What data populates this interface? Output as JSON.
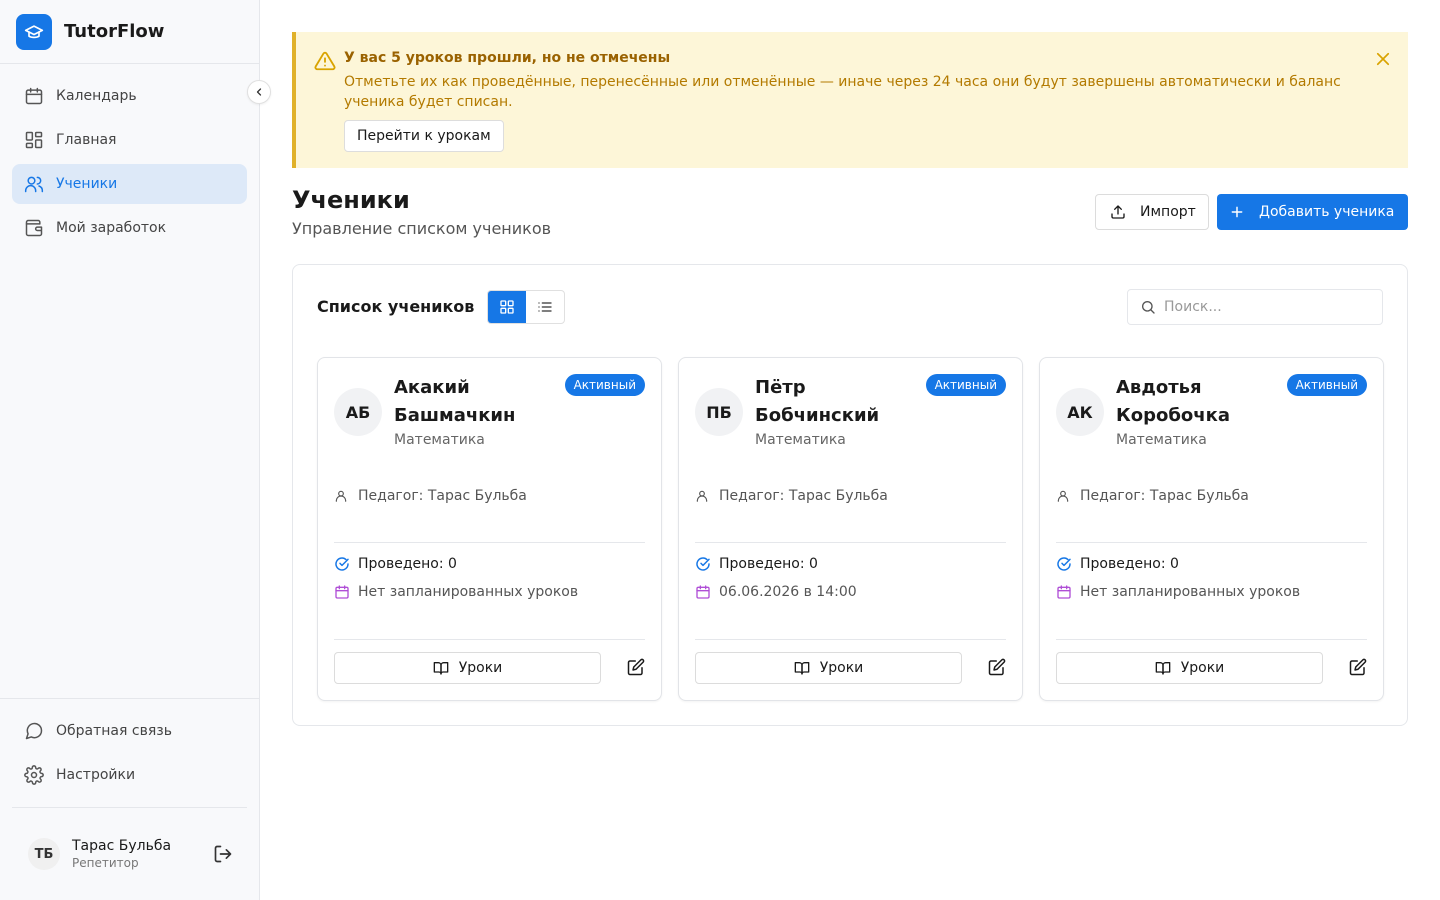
{
  "brand": {
    "name": "TutorFlow"
  },
  "sidebar": {
    "items": [
      {
        "label": "Календарь"
      },
      {
        "label": "Главная"
      },
      {
        "label": "Ученики"
      },
      {
        "label": "Мой заработок"
      }
    ],
    "bottom": [
      {
        "label": "Обратная связь"
      },
      {
        "label": "Настройки"
      }
    ],
    "user": {
      "initials": "ТБ",
      "name": "Тарас Бульба",
      "role": "Репетитор"
    }
  },
  "alert": {
    "title": "У вас 5 уроков прошли, но не отмечены",
    "text": "Отметьте их как проведённые, перенесённые или отменённые — иначе через 24 часа они будут завершены автоматически и баланс ученика будет списан.",
    "button": "Перейти к урокам"
  },
  "page": {
    "title": "Ученики",
    "subtitle": "Управление списком учеников",
    "import_label": "Импорт",
    "add_label": "Добавить ученика"
  },
  "panel": {
    "title": "Список учеников",
    "search_placeholder": "Поиск..."
  },
  "students": [
    {
      "initials": "АБ",
      "name": "Акакий Башмачкин",
      "subject": "Математика",
      "status": "Активный",
      "teacher": "Педагог: Тарас Бульба",
      "done": "Проведено: 0",
      "next": "Нет запланированных уроков",
      "lessons_label": "Уроки"
    },
    {
      "initials": "ПБ",
      "name": "Пётр Бобчинский",
      "subject": "Математика",
      "status": "Активный",
      "teacher": "Педагог: Тарас Бульба",
      "done": "Проведено: 0",
      "next": "06.06.2026 в 14:00",
      "lessons_label": "Уроки"
    },
    {
      "initials": "АК",
      "name": "Авдотья Коробочка",
      "subject": "Математика",
      "status": "Активный",
      "teacher": "Педагог: Тарас Бульба",
      "done": "Проведено: 0",
      "next": "Нет запланированных уроков",
      "lessons_label": "Уроки"
    }
  ],
  "colors": {
    "accent": "#1677e6",
    "alert_bg": "#fdf6d8",
    "alert_border": "#e0b12a",
    "done_icon": "#1677e6",
    "calendar_icon": "#b04fd6"
  },
  "icons": {
    "brand": "graduation-cap-icon",
    "nav": [
      "calendar-icon",
      "dashboard-icon",
      "users-icon",
      "wallet-icon"
    ],
    "bottom": [
      "message-circle-icon",
      "gear-icon"
    ],
    "alert": "warning-triangle-icon",
    "card": [
      "user-icon",
      "check-circle-icon",
      "calendar-icon",
      "book-icon",
      "edit-icon"
    ]
  }
}
